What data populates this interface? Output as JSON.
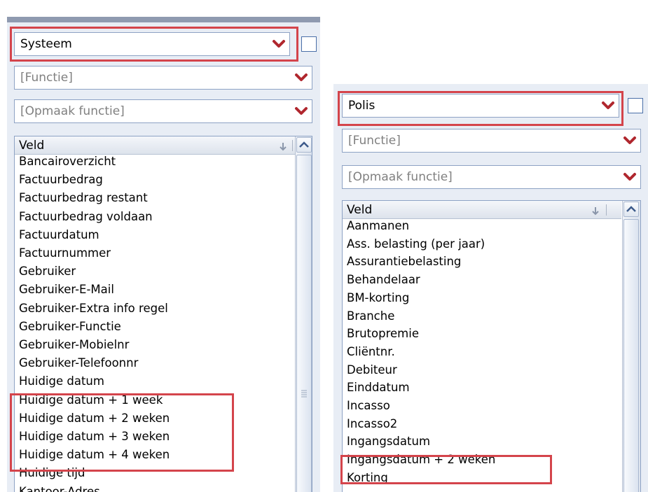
{
  "left": {
    "category_select": {
      "value": "Systeem"
    },
    "function_select": {
      "placeholder": "[Functie]"
    },
    "format_select": {
      "placeholder": "[Opmaak functie]"
    },
    "list": {
      "header": "Veld",
      "items": [
        "Bancairoverzicht",
        "Factuurbedrag",
        "Factuurbedrag restant",
        "Factuurbedrag voldaan",
        "Factuurdatum",
        "Factuurnummer",
        "Gebruiker",
        "Gebruiker-E-Mail",
        "Gebruiker-Extra info regel",
        "Gebruiker-Functie",
        "Gebruiker-Mobielnr",
        "Gebruiker-Telefoonnr",
        "Huidige datum",
        "Huidige datum + 1 week",
        "Huidige datum + 2 weken",
        "Huidige datum + 3 weken",
        "Huidige datum + 4 weken",
        "Huidige tijd",
        "Kantoor-Adres"
      ]
    }
  },
  "right": {
    "category_select": {
      "value": "Polis"
    },
    "function_select": {
      "placeholder": "[Functie]"
    },
    "format_select": {
      "placeholder": "[Opmaak functie]"
    },
    "list": {
      "header": "Veld",
      "items": [
        "Aanmanen",
        "Ass. belasting (per jaar)",
        "Assurantiebelasting",
        "Behandelaar",
        "BM-korting",
        "Branche",
        "Brutopremie",
        "Cliëntnr.",
        "Debiteur",
        "Einddatum",
        "Incasso",
        "Incasso2",
        "Ingangsdatum",
        "Ingangsdatum + 2 weken",
        "Korting"
      ]
    }
  },
  "colors": {
    "highlight_box": "#d4444b",
    "panel_bg": "#e8edf5",
    "dropdown_arrow": "#b0272e"
  }
}
